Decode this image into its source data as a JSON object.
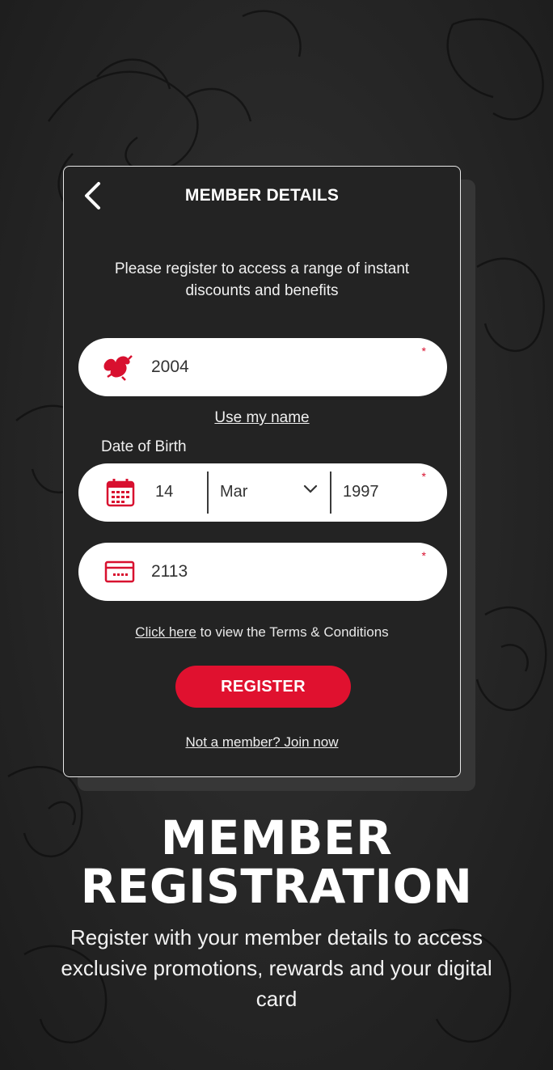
{
  "card": {
    "title": "MEMBER DETAILS",
    "intro": "Please register to access a range of instant discounts and benefits"
  },
  "member_field": {
    "value": "2004",
    "required_marker": "*",
    "icon": "dragon-logo-icon"
  },
  "use_name_link": "Use my name",
  "dob": {
    "label": "Date of Birth",
    "day": "14",
    "month": "Mar",
    "year": "1997",
    "required_marker": "*",
    "icon": "calendar-icon"
  },
  "code_field": {
    "value": "2113",
    "required_marker": "*",
    "icon": "card-icon"
  },
  "terms": {
    "link": "Click here",
    "text": " to view the Terms & Conditions"
  },
  "register_button": "REGISTER",
  "join_link": "Not a member? Join now",
  "promo": {
    "headline_line1": "MEMBER",
    "headline_line2": "REGISTRATION",
    "subtitle": "Register with your member details to access exclusive promotions, rewards and your digital card"
  },
  "colors": {
    "accent": "#e0112f",
    "background": "#262626"
  }
}
